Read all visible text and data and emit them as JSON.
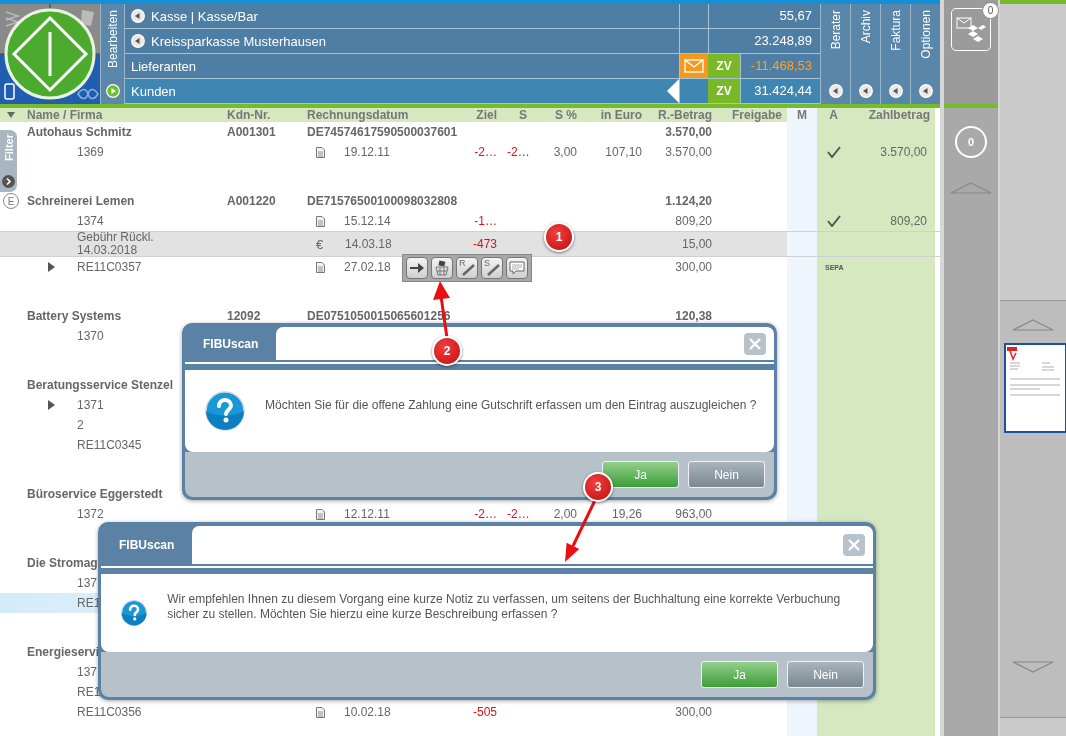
{
  "header": {
    "edit_tab": "Bearbeiten",
    "accounts": [
      {
        "name": "Kasse | Kasse/Bar",
        "expandable": true,
        "mail": false,
        "amount": "55,67",
        "negative": false,
        "current": false
      },
      {
        "name": "Kreissparkasse Musterhausen",
        "expandable": true,
        "mail": false,
        "amount": "23.248,89",
        "negative": false,
        "current": false
      },
      {
        "name": "Lieferanten",
        "expandable": false,
        "mail": true,
        "zv": "ZV",
        "amount": "-11.468,53",
        "negative": true,
        "current": false
      },
      {
        "name": "Kunden",
        "expandable": false,
        "mail": false,
        "zv": "ZV",
        "amount": "31.424,44",
        "negative": false,
        "current": true
      }
    ],
    "side_tabs": [
      "Berater",
      "Archiv",
      "Faktura",
      "Optionen"
    ]
  },
  "filter_tab": "Filter",
  "table": {
    "columns": [
      "Name / Firma",
      "Kdn-Nr.",
      "Rechnungsdatum",
      "Ziel",
      "S",
      "S %",
      "in Euro",
      "R.-Betrag",
      "Freigabe",
      "M",
      "A",
      "Zahlbetrag"
    ],
    "groups": [
      {
        "name": "Autohaus Schmitz",
        "customer_no": "A001301",
        "iban": "DE74574617590500037601",
        "total": "3.570,00",
        "rows": [
          {
            "kind": "document",
            "name": "1369",
            "date": "19.12.11",
            "ziel": "-2…",
            "s": "-2…",
            "s_pct": "3,00",
            "in_euro": "107,10",
            "amount": "3.570,00",
            "paid": true,
            "pay_amount": "3.570,00",
            "collapsed": false,
            "hovered": false,
            "selected": false
          }
        ]
      },
      {
        "name": "Schreinerei Lemen",
        "badge": "E",
        "customer_no": "A001220",
        "iban": "DE71576500100098032808",
        "total": "1.124,20",
        "rows": [
          {
            "kind": "document",
            "name": "1374",
            "date": "15.12.14",
            "ziel": "-1…",
            "amount": "809,20",
            "paid": true,
            "pay_amount": "809,20",
            "collapsed": false,
            "hovered": false,
            "selected": false
          },
          {
            "kind": "fee",
            "name": "Gebühr Rückl.\n14.03.2018",
            "symbol": "€",
            "date": "14.03.18",
            "ziel": "-473",
            "amount": "15,00",
            "paid": false,
            "collapsed": false,
            "hovered": true,
            "selected": false
          },
          {
            "kind": "document",
            "name": "RE11C0357",
            "date": "27.02.18",
            "amount": "300,00",
            "mark_label": "SEPA",
            "paid": false,
            "collapsed": true,
            "hovered": false,
            "selected": false
          }
        ]
      },
      {
        "name": "Battery Systems",
        "customer_no": "12092",
        "iban": "DE0751050015065601256",
        "total": "120,38",
        "rows": [
          {
            "kind": "plain",
            "name": "1370",
            "paid": false,
            "collapsed": false,
            "hovered": false,
            "selected": false
          }
        ]
      },
      {
        "name": "Beratungsservice Stenzel",
        "rows": [
          {
            "kind": "plain",
            "name": "1371",
            "paid": false,
            "collapsed": true,
            "hovered": false,
            "selected": false
          },
          {
            "kind": "plain",
            "name": "2",
            "paid": false,
            "collapsed": false,
            "hovered": false,
            "selected": false
          },
          {
            "kind": "plain",
            "name": "RE11C0345",
            "paid": false,
            "collapsed": false,
            "hovered": false,
            "selected": false
          }
        ]
      },
      {
        "name": "Büroservice Eggerstedt",
        "rows": [
          {
            "kind": "document",
            "name": "1372",
            "date": "12.12.11",
            "ziel": "-2…",
            "s": "-2…",
            "s_pct": "2,00",
            "in_euro": "19,26",
            "amount": "963,00",
            "paid": false,
            "collapsed": false,
            "hovered": false,
            "selected": false
          }
        ]
      },
      {
        "name": "Die Stromag",
        "rows": [
          {
            "kind": "plain",
            "name": "137",
            "paid": false,
            "collapsed": false,
            "hovered": false,
            "selected": false
          },
          {
            "kind": "plain",
            "name": "RE1",
            "paid": false,
            "collapsed": false,
            "hovered": false,
            "selected": true
          }
        ]
      },
      {
        "name": "Energieservi",
        "rows": [
          {
            "kind": "plain",
            "name": "137",
            "paid": false,
            "collapsed": false,
            "hovered": false,
            "selected": false
          },
          {
            "kind": "plain",
            "name": "RE1",
            "paid": false,
            "collapsed": false,
            "hovered": false,
            "selected": false
          },
          {
            "kind": "document",
            "name": "RE11C0356",
            "date": "10.02.18",
            "ziel": "-505",
            "amount": "300,00",
            "paid": false,
            "collapsed": false,
            "hovered": false,
            "selected": false
          }
        ]
      }
    ]
  },
  "row_toolbar": [
    {
      "kind": "forward"
    },
    {
      "kind": "basket"
    },
    {
      "kind": "edit",
      "letter": "R"
    },
    {
      "kind": "edit",
      "letter": "S"
    },
    {
      "kind": "comment"
    }
  ],
  "dialogs": [
    {
      "title": "FIBUscan",
      "message": "Möchten Sie für die offene Zahlung eine Gutschrift erfassen um den Eintrag auszugleichen ?",
      "buttons": [
        {
          "label": "Ja",
          "kind": "primary"
        },
        {
          "label": "Nein",
          "kind": "secondary"
        }
      ]
    },
    {
      "title": "FIBUscan",
      "message": "Wir empfehlen Ihnen zu diesem Vorgang eine kurze Notiz zu verfassen, um seitens der Buchhaltung eine korrekte Verbuchung sicher zu stellen. Möchten Sie hierzu eine kurze Beschreibung erfassen ?",
      "buttons": [
        {
          "label": "Ja",
          "kind": "primary"
        },
        {
          "label": "Nein",
          "kind": "secondary"
        }
      ]
    }
  ],
  "annotations": [
    "1",
    "2",
    "3"
  ],
  "sidebar": {
    "inbox_count": "0",
    "queue_count": "0"
  }
}
